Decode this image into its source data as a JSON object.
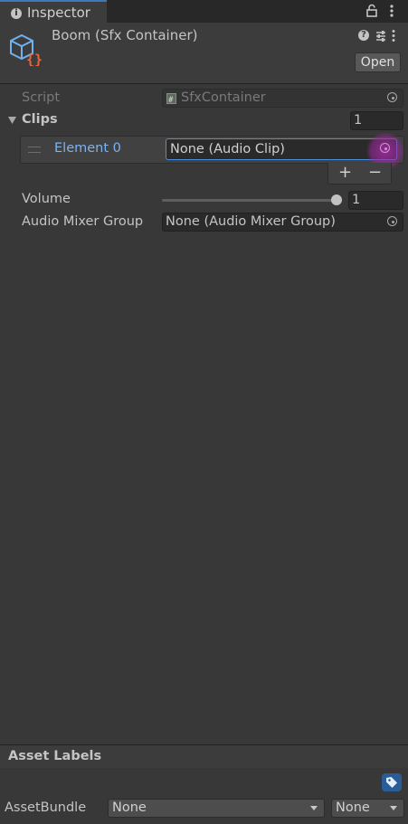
{
  "tab": {
    "label": "Inspector"
  },
  "header": {
    "title": "Boom (Sfx Container)",
    "open_label": "Open"
  },
  "fields": {
    "script": {
      "label": "Script",
      "value": "SfxContainer"
    },
    "clips": {
      "label": "Clips",
      "count": "1"
    },
    "element0": {
      "label": "Element 0",
      "value": "None (Audio Clip)"
    },
    "volume": {
      "label": "Volume",
      "value": "1",
      "level": 1.0
    },
    "mixer": {
      "label": "Audio Mixer Group",
      "value": "None (Audio Mixer Group)"
    }
  },
  "list_buttons": {
    "add": "+",
    "remove": "−"
  },
  "asset_labels": {
    "title": "Asset Labels",
    "assetbundle_label": "AssetBundle",
    "bundle_value": "None",
    "variant_value": "None"
  },
  "colors": {
    "accent": "#3a79bb",
    "element_label": "#7cb3f0",
    "picker_highlight": "#aa28aa",
    "script_icon_accent": "#e8643c"
  },
  "icons": [
    "info-icon",
    "lock-icon",
    "menu-icon",
    "script-object-icon",
    "help-icon",
    "preset-icon",
    "kebab-icon",
    "object-picker-icon",
    "drag-handle-icon",
    "tag-icon",
    "dropdown-arrow-icon",
    "foldout-arrow-icon",
    "script-file-icon"
  ]
}
